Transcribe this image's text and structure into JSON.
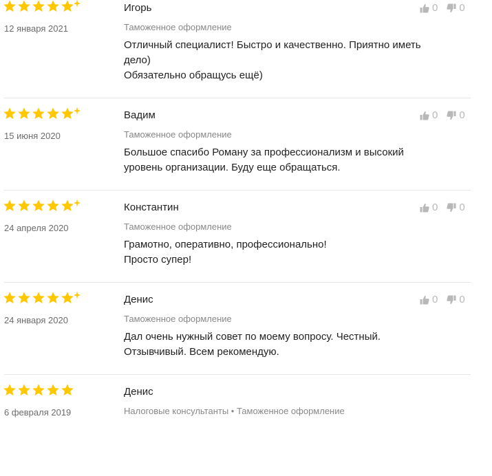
{
  "colors": {
    "star": "#FFC800",
    "divider": "#E6E6E6",
    "muted": "#888888",
    "vote": "#B8B8B8"
  },
  "reviews": [
    {
      "rating": 5,
      "sparkle": true,
      "date": "12 января 2021",
      "author": "Игорь",
      "categories": "Таможенное оформление",
      "text_lines": [
        "Отличный специалист! Быстро и качественно. Приятно иметь",
        "дело)",
        "Обязательно обращусь ещё)"
      ],
      "likes": "0",
      "dislikes": "0"
    },
    {
      "rating": 5,
      "sparkle": true,
      "date": "15 июня 2020",
      "author": "Вадим",
      "categories": "Таможенное оформление",
      "text_lines": [
        "Большое спасибо Роману за профессионализм и высокий",
        "уровень организации. Буду еще обращаться."
      ],
      "likes": "0",
      "dislikes": "0"
    },
    {
      "rating": 5,
      "sparkle": true,
      "date": "24 апреля 2020",
      "author": "Константин",
      "categories": "Таможенное оформление",
      "text_lines": [
        "Грамотно, оперативно, профессионально!",
        "Просто супер!"
      ],
      "likes": "0",
      "dislikes": "0"
    },
    {
      "rating": 5,
      "sparkle": true,
      "date": "24 января 2020",
      "author": "Денис",
      "categories": "Таможенное оформление",
      "text_lines": [
        "Дал очень нужный совет по моему вопросу. Честный.",
        "Отзывчивый. Всем рекомендую."
      ],
      "likes": "0",
      "dislikes": "0"
    },
    {
      "rating": 5,
      "sparkle": false,
      "date": "6 февраля 2019",
      "author": "Денис",
      "categories": "Налоговые консультанты • Таможенное оформление",
      "text_lines": [],
      "likes": null,
      "dislikes": null
    }
  ]
}
